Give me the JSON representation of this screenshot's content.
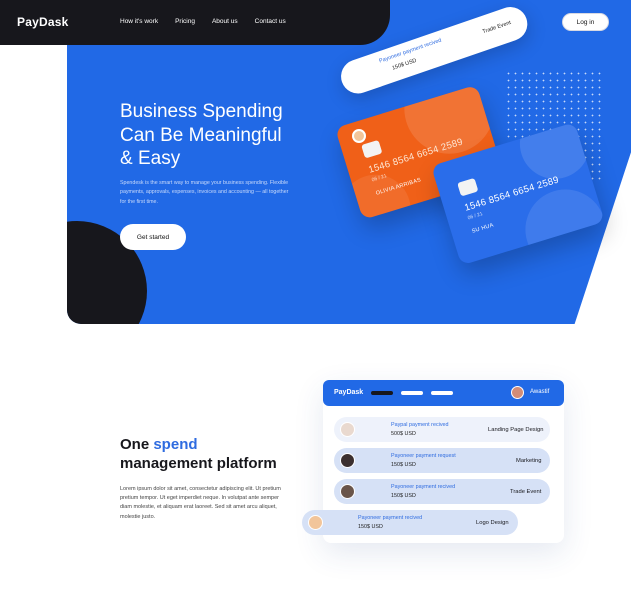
{
  "header": {
    "logo": "PayDask",
    "nav": [
      "How it's work",
      "Pricing",
      "About us",
      "Contact us"
    ],
    "login_label": "Log in"
  },
  "hero": {
    "title_line1": "Business Spending",
    "title_line2": "Can Be Meaningful",
    "title_line3": "& Easy",
    "description": "Spendesk is the smart way to manage your business spending. Flexible payments, approvals, expenses, invoices and accounting — all together for the first time.",
    "cta_label": "Get started",
    "notification": {
      "title": "Payoneer payment recived",
      "amount": "150$ USD",
      "tag": "Trade Event"
    },
    "card_orange": {
      "number": "1546 8564 6654 2589",
      "expiry": "06 / 21",
      "holder": "OLIVIA ARRIBAS"
    },
    "card_blue": {
      "number": "1546 8564 6654 2589",
      "expiry": "06 / 21",
      "holder": "SU HUA"
    }
  },
  "section2": {
    "title_pre": "One ",
    "title_accent": "spend",
    "title_post": "management platform",
    "description": "Lorem ipsum dolor sit amet, consectetur adipiscing elit. Ut pretium pretium tempor. Ut eget imperdiet neque. In volutpat ante semper diam molestie, et aliquam erat laoreet. Sed sit amet arcu aliquet, molestie justo.",
    "panel": {
      "logo": "PayDask",
      "user": "Awastif",
      "rows": [
        {
          "title": "Paypal payment recived",
          "amount": "500$ USD",
          "tag": "Landing Page Design"
        },
        {
          "title": "Payoneer payment request",
          "amount": "150$ USD",
          "tag": "Marketing"
        },
        {
          "title": "Payoneer payment recived",
          "amount": "150$ USD",
          "tag": "Trade Event"
        },
        {
          "title": "Payoneer payment recived",
          "amount": "150$ USD",
          "tag": "Logo Design"
        }
      ]
    }
  },
  "colors": {
    "brand_blue": "#2169e6",
    "dark": "#17171c",
    "orange_card": "#f06018",
    "row_blue": "#d6e1f6"
  }
}
